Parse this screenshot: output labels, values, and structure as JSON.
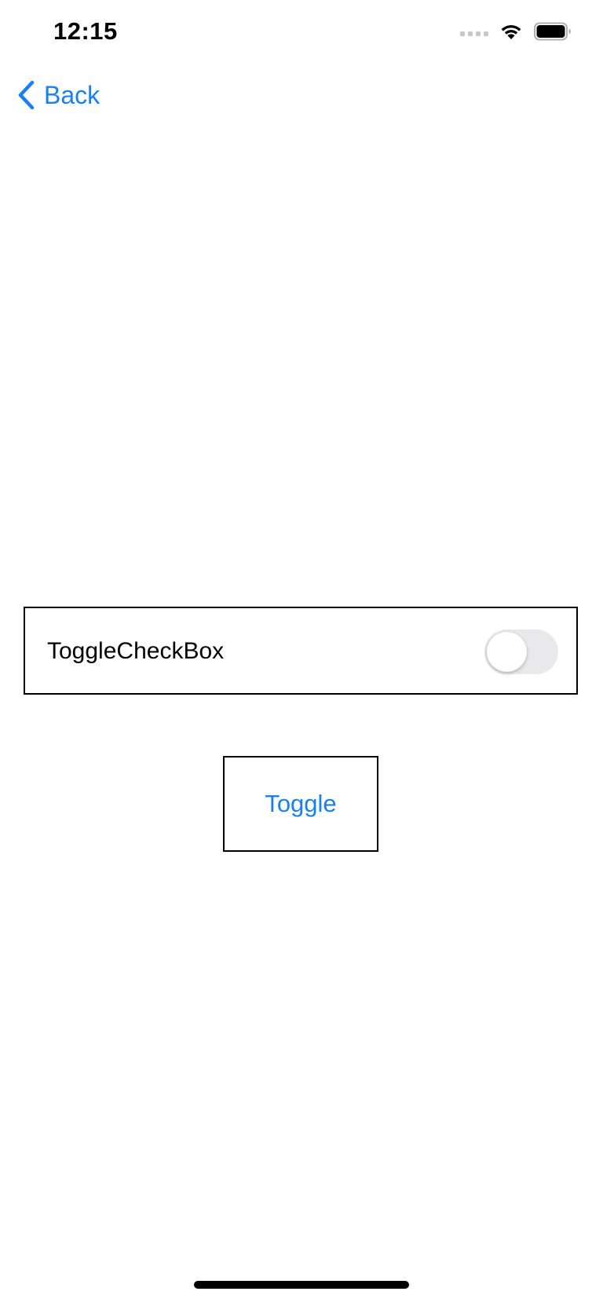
{
  "status_bar": {
    "time": "12:15",
    "icons": [
      "cellular-signal-icon",
      "wifi-icon",
      "battery-icon"
    ]
  },
  "nav": {
    "back_label": "Back",
    "back_icon": "chevron-left-icon"
  },
  "toggle_row": {
    "label": "ToggleCheckBox",
    "switch_on": false
  },
  "toggle_button": {
    "label": "Toggle"
  },
  "colors": {
    "accent": "#1a7ff0",
    "switch_off_track": "#e9e9eb",
    "border": "#000000",
    "background": "#ffffff"
  }
}
